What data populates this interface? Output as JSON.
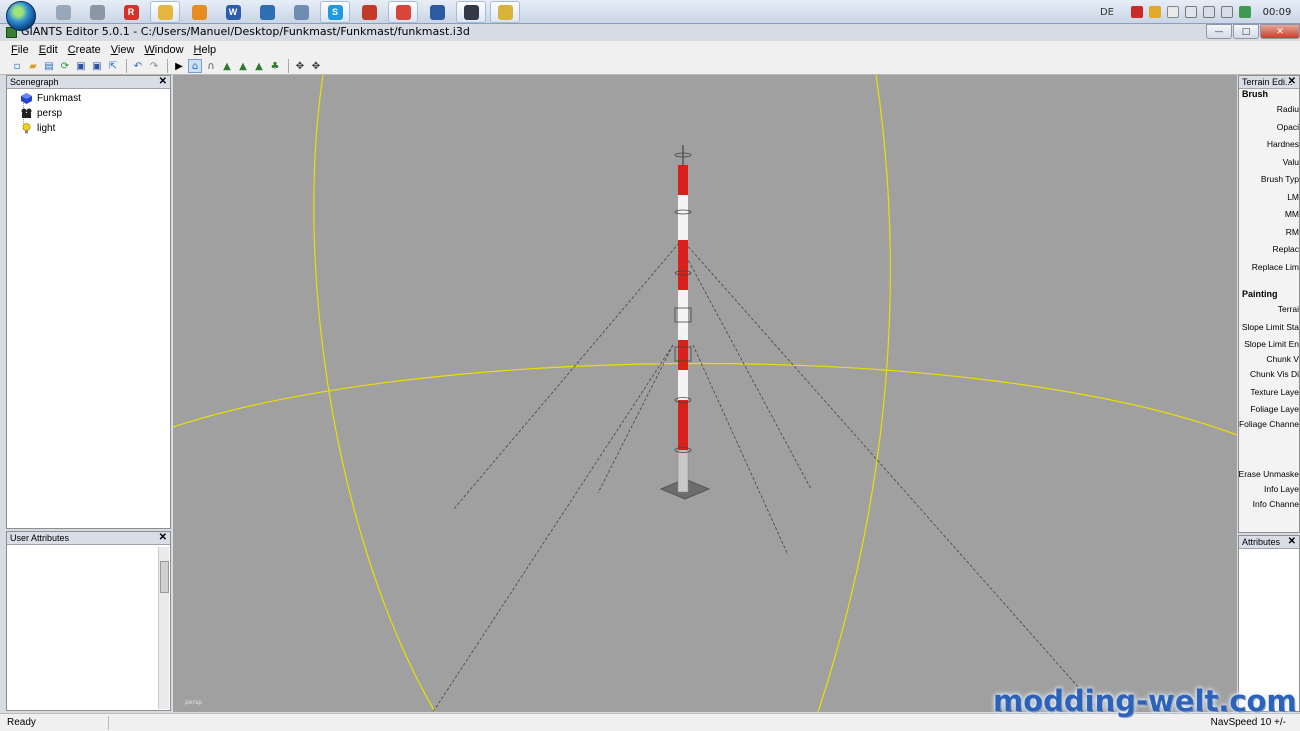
{
  "taskbar": {
    "apps": [
      {
        "name": "pinned-app-1",
        "color": "#9aa7b8"
      },
      {
        "name": "pinned-app-2",
        "color": "#8b96a6"
      },
      {
        "name": "pinned-app-3",
        "color": "#d3342a",
        "glyph": "R"
      },
      {
        "name": "explorer",
        "color": "#e6b640"
      },
      {
        "name": "media-player",
        "color": "#e78b22"
      },
      {
        "name": "word",
        "color": "#2a5dab",
        "glyph": "W"
      },
      {
        "name": "browser-globe",
        "color": "#2e6fb4"
      },
      {
        "name": "pinned-app-8",
        "color": "#6f8db2"
      },
      {
        "name": "skype",
        "color": "#1e9be0",
        "glyph": "S"
      },
      {
        "name": "pinned-app-10",
        "color": "#c43a2a"
      },
      {
        "name": "chrome",
        "color": "#d9453a"
      },
      {
        "name": "pinned-app-12",
        "color": "#2d5aa0"
      },
      {
        "name": "steam",
        "color": "#333a46"
      },
      {
        "name": "giants-editor",
        "color": "#d8b23a"
      }
    ],
    "lang": "DE",
    "clock": "00:09"
  },
  "window": {
    "title": "GIANTS Editor 5.0.1 - C:/Users/Manuel/Desktop/Funkmast/Funkmast/funkmast.i3d",
    "minimize": "—",
    "maximize": "□",
    "close": "✕"
  },
  "menu": [
    "File",
    "Edit",
    "Create",
    "View",
    "Window",
    "Help"
  ],
  "scenegraph": {
    "title": "Scenegraph",
    "close": "✕",
    "nodes": [
      "Funkmast",
      "persp",
      "light"
    ]
  },
  "user_attributes": {
    "title": "User Attributes",
    "close": "✕"
  },
  "viewport": {
    "camera_label": "persp"
  },
  "terrain_editor": {
    "title": "Terrain Edi...",
    "close": "✕",
    "brush_heading": "Brush",
    "brush_rows": [
      "Radiu",
      "Opaci",
      "Hardnes",
      "Valu",
      "Brush Typ",
      "LM",
      "MM",
      "RM",
      "Replac",
      "Replace Lim"
    ],
    "painting_heading": "Painting",
    "painting_rows": [
      "Terrai",
      "Slope Limit Sta",
      "Slope Limit En",
      "Chunk V",
      "Chunk Vis Di",
      "Texture Laye",
      "Foliage Laye",
      "Foliage Channe",
      "Erase Unmaske",
      "Info Laye",
      "Info Channe"
    ]
  },
  "attributes_panel": {
    "title": "Attributes",
    "close": "✕"
  },
  "status": {
    "text": "Ready",
    "navspeed": "NavSpeed 10 +/-"
  },
  "watermark": "modding-welt.com",
  "colors": {
    "viewport_bg": "#a0a0a0",
    "mast_red": "#d8201c",
    "mast_white": "#f4f4f4",
    "grid_yellow": "#e8e000"
  }
}
